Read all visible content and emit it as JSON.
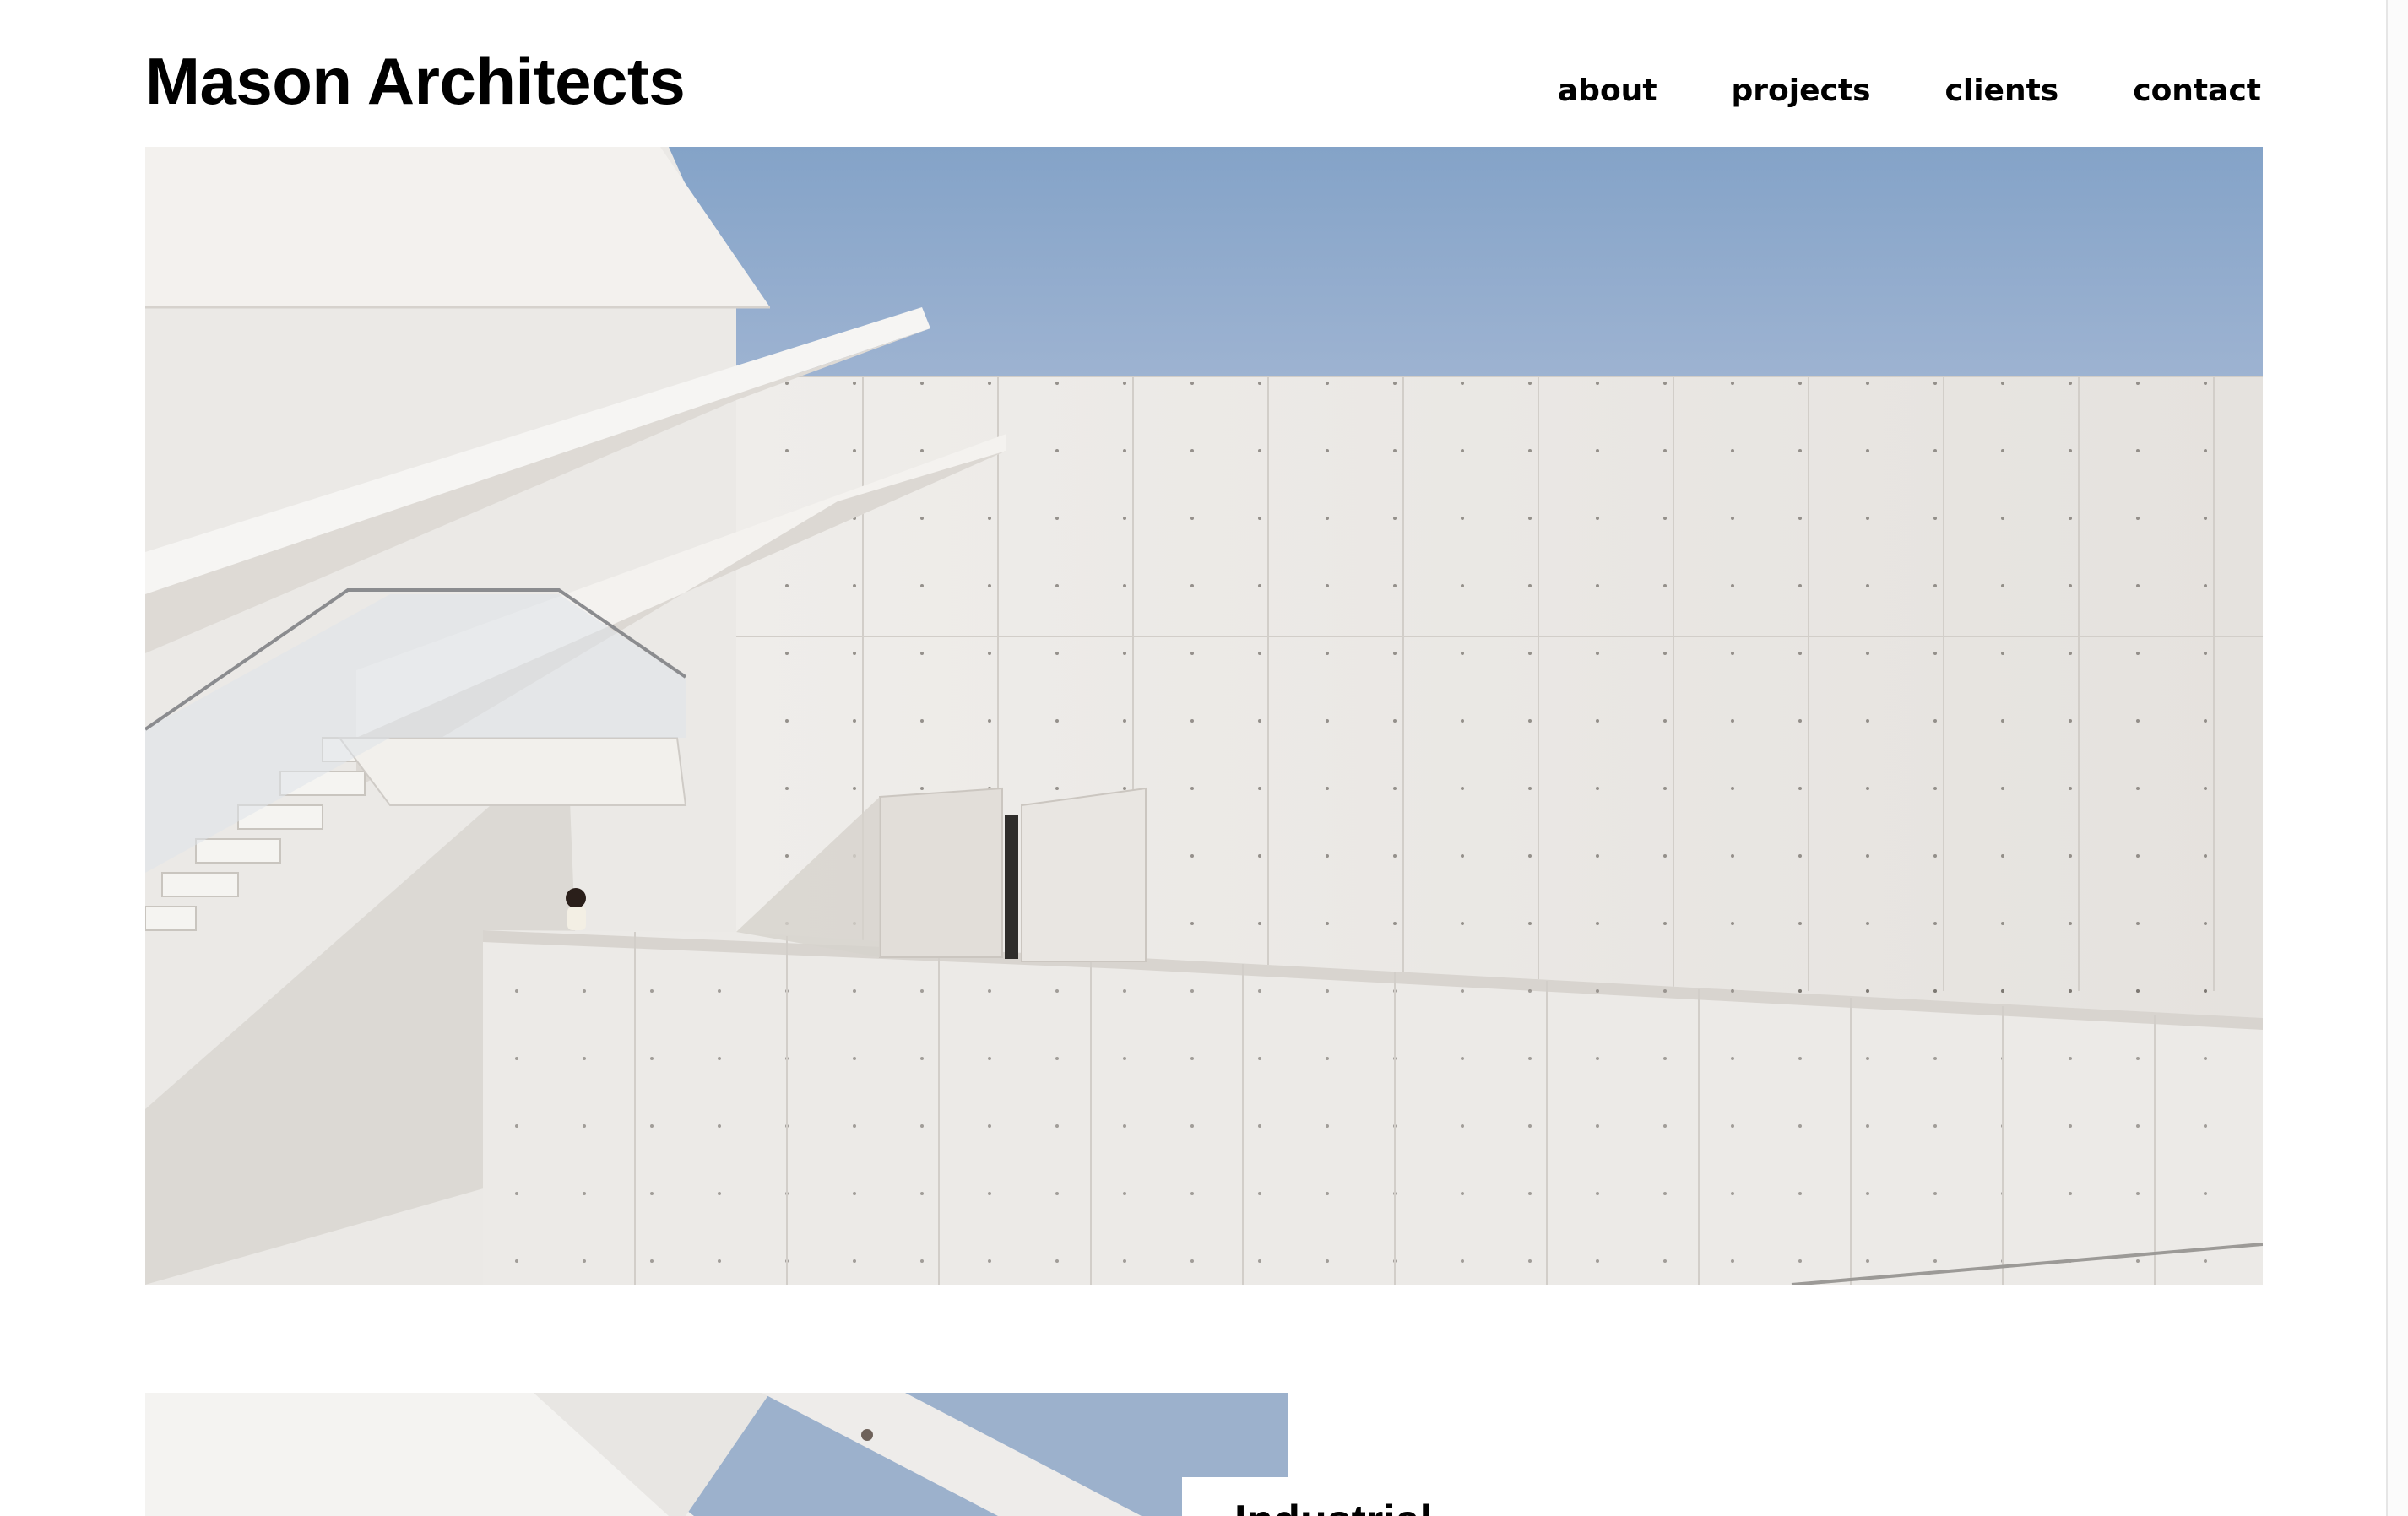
{
  "site": {
    "title": "Mason Architects"
  },
  "nav": {
    "items": [
      "about",
      "projects",
      "clients",
      "contact"
    ]
  },
  "hero": {
    "image_icon": "photo-icon"
  },
  "project": {
    "title": "Industrial"
  },
  "colors": {
    "sky": "#8fa9cc",
    "concrete": "#e8e5e1",
    "text": "#000000",
    "background": "#ffffff"
  }
}
